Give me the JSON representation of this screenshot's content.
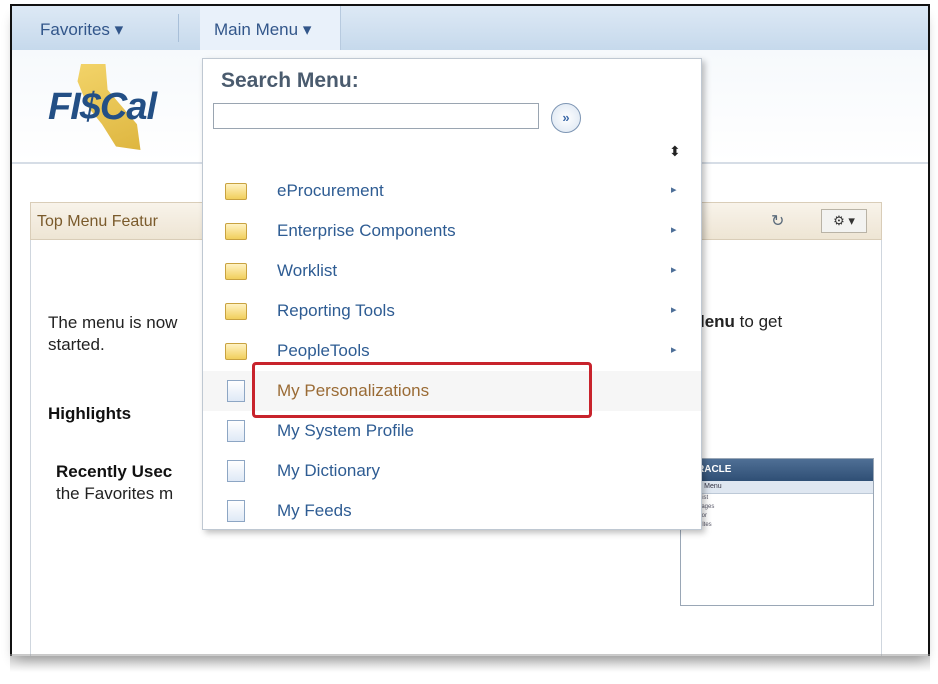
{
  "nav": {
    "favorites": "Favorites ▾",
    "main_menu": "Main Menu ▾"
  },
  "logo": {
    "text": "FI$Cal"
  },
  "pagelet": {
    "title": "Top Menu Featur",
    "gear": "⚙ ▾"
  },
  "body": {
    "line1_left": "The menu is now",
    "line1_right_bold": "lenu",
    "line1_right": " to get",
    "line2": "started.",
    "highlights": "Highlights",
    "recent_bold": "Recently Usec",
    "recent_text": "the Favorites m"
  },
  "search": {
    "label": "Search Menu:",
    "value": "",
    "go": "»"
  },
  "menu_items": [
    {
      "label": "eProcurement",
      "icon": "folder-icon",
      "arrow": "▸"
    },
    {
      "label": "Enterprise Components",
      "icon": "folder-icon",
      "arrow": "▸"
    },
    {
      "label": "Worklist",
      "icon": "folder-icon",
      "arrow": "▸"
    },
    {
      "label": "Reporting Tools",
      "icon": "folder-icon",
      "arrow": "▸"
    },
    {
      "label": "PeopleTools",
      "icon": "folder-icon",
      "arrow": "▸"
    },
    {
      "label": "My Personalizations",
      "icon": "document-icon",
      "arrow": ""
    },
    {
      "label": "My System Profile",
      "icon": "document-icon",
      "arrow": ""
    },
    {
      "label": "My Dictionary",
      "icon": "document-icon",
      "arrow": ""
    },
    {
      "label": "My Feeds",
      "icon": "document-icon",
      "arrow": ""
    }
  ],
  "thumbnail": {
    "brand": "RACLE",
    "bar": "Main Menu",
    "lines": [
      "Worklist",
      "Messages",
      "Monitor",
      "Favorites"
    ]
  },
  "colors": {
    "accent": "#2e5c93",
    "highlight_border": "#c8232c"
  }
}
